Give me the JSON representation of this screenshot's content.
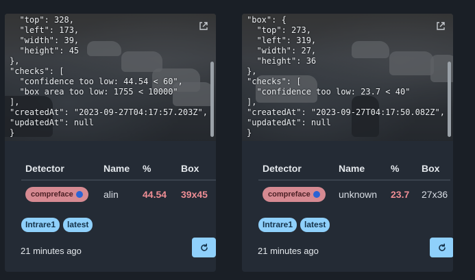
{
  "cards": [
    {
      "json_text": "  \"top\": 328,\n  \"left\": 173,\n  \"width\": 39,\n  \"height\": 45\n},\n\"checks\": [\n  \"confidence too low: 44.54 < 60\",\n  \"box area too low: 1755 < 10000\"\n],\n\"createdAt\": \"2023-09-27T04:17:57.203Z\",\n\"updatedAt\": null\n}",
      "headers": {
        "detector": "Detector",
        "name": "Name",
        "pct": "%",
        "box": "Box"
      },
      "row": {
        "detector": "compreface",
        "name": "alin",
        "pct": "44.54",
        "box": "39x45"
      },
      "tags": [
        "Intrare1",
        "latest"
      ],
      "time": "21 minutes ago"
    },
    {
      "json_text": "\"box\": {\n  \"top\": 273,\n  \"left\": 319,\n  \"width\": 27,\n  \"height\": 36\n},\n\"checks\": [\n  \"confidence too low: 23.7 < 40\"\n],\n\"createdAt\": \"2023-09-27T04:17:50.082Z\",\n\"updatedAt\": null\n}",
      "headers": {
        "detector": "Detector",
        "name": "Name",
        "pct": "%",
        "box": "Box"
      },
      "row": {
        "detector": "compreface",
        "name": "unknown",
        "pct": "23.7",
        "box": "27x36"
      },
      "tags": [
        "Intrare1",
        "latest"
      ],
      "time": "21 minutes ago"
    }
  ],
  "icons": {
    "external": "external-link-icon",
    "refresh": "refresh-icon",
    "status_dot": "status-dot-icon"
  },
  "colors": {
    "accent": "#8fd0fb",
    "detector_pill": "#d68a92",
    "alert_text": "#ef8e95",
    "dot": "#2a63d4"
  }
}
